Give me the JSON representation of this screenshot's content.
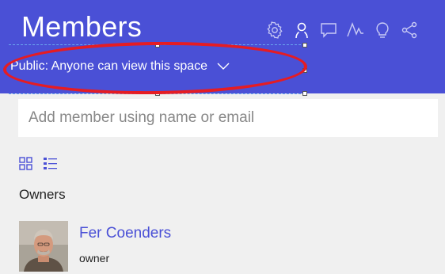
{
  "header": {
    "title": "Members",
    "visibility_label": "Public: Anyone can view this space",
    "icons": [
      "gear-icon",
      "person-icon",
      "comment-icon",
      "activity-icon",
      "lightbulb-icon",
      "share-icon"
    ],
    "bg_color": "#4a50d6"
  },
  "search": {
    "placeholder": "Add member using name or email"
  },
  "view": {
    "icons": [
      "grid-view-icon",
      "list-view-icon"
    ]
  },
  "sections": {
    "owners_label": "Owners"
  },
  "members": [
    {
      "name": "Fer Coenders",
      "role": "owner"
    }
  ],
  "annotation": {
    "color": "#e51c23"
  }
}
